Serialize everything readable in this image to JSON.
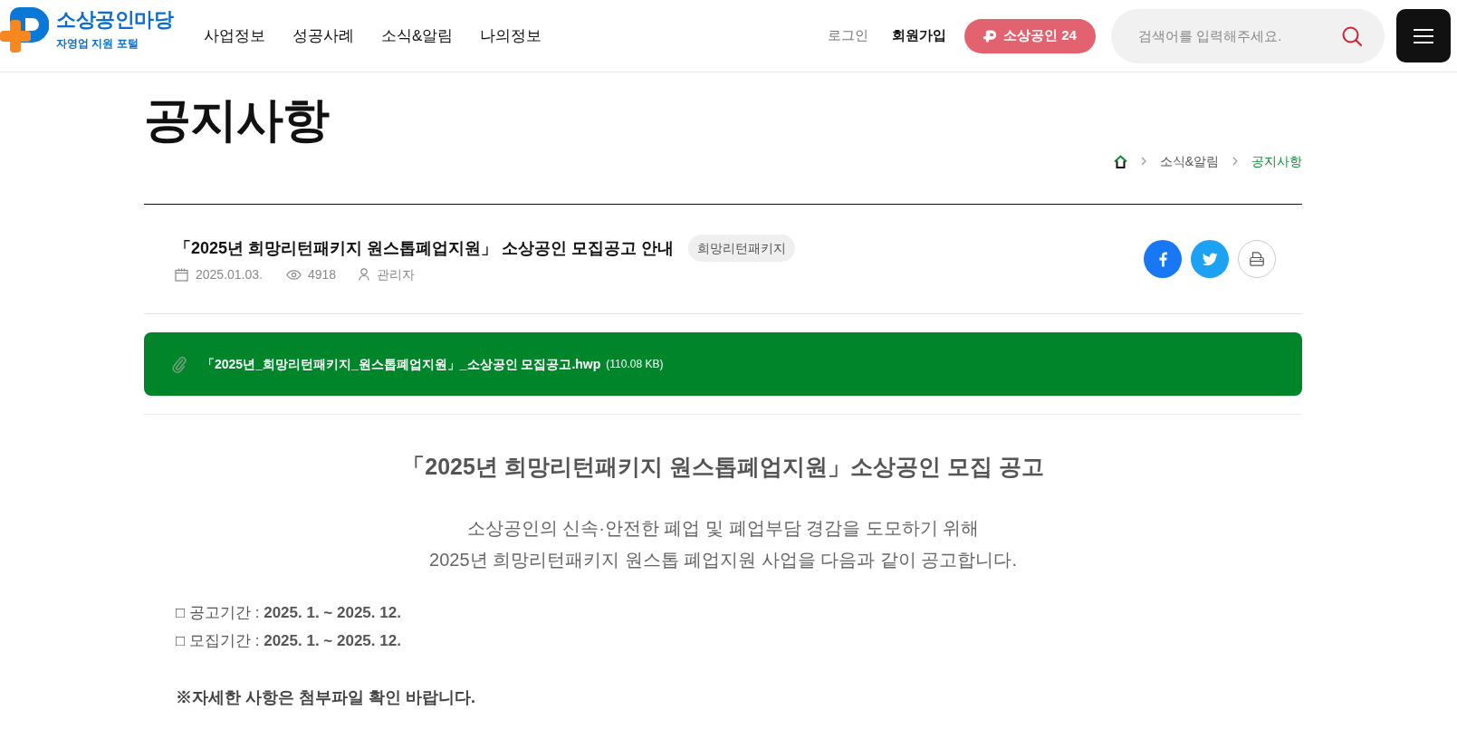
{
  "header": {
    "logo": {
      "title": "소상공인마당",
      "subtitle": "자영업 지원 포털"
    },
    "nav": [
      "사업정보",
      "성공사례",
      "소식&알림",
      "나의정보"
    ],
    "login": "로그인",
    "signup": "회원가입",
    "partner_button": "소상공인 24",
    "search": {
      "placeholder": "검색어를 입력해주세요."
    }
  },
  "page_title": "공지사항",
  "breadcrumb": [
    {
      "label": "소식&알림",
      "selected": false
    },
    {
      "label": "공지사항",
      "selected": true
    }
  ],
  "post": {
    "title": "「2025년 희망리턴패키지 원스톱폐업지원」 소상공인 모집공고 안내",
    "tag": "희망리턴패키지",
    "date": "2025.01.03.",
    "views": "4918",
    "author": "관리자"
  },
  "attachments": [
    {
      "name": "「2025년_희망리턴패키지_원스톱폐업지원」_소상공인 모집공고.hwp",
      "size": "(110.08 KB)"
    }
  ],
  "body": {
    "heading": "「2025년 희망리턴패키지 원스톱폐업지원」소상공인 모집 공고",
    "intro": [
      "소상공인의 신속·안전한 폐업 및 폐업부담 경감을 도모하기 위해",
      "2025년 희망리턴패키지 원스톱 폐업지원 사업을 다음과 같이 공고합니다."
    ],
    "items": [
      "□ 공고기간 : **2025. 1. ~ 2025. 12.**",
      "□ 모집기간 : **2025. 1. ~ 2025. 12.**"
    ],
    "note": "※자세한 사항은 첨부파일 확인 바랍니다."
  }
}
